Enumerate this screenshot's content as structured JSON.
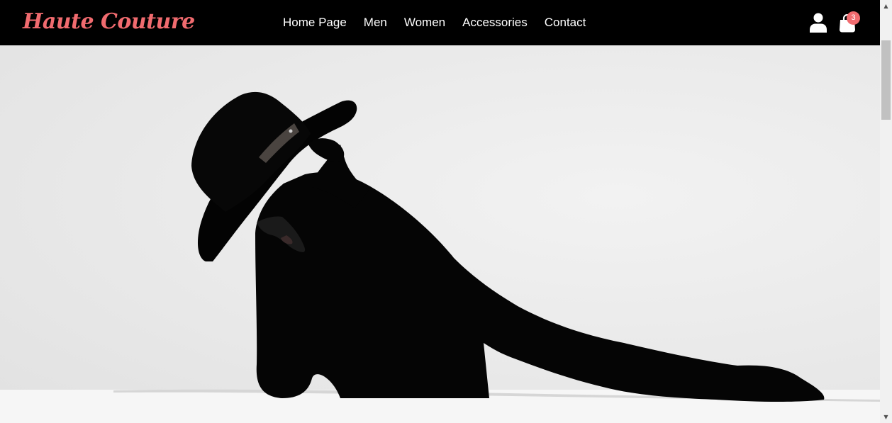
{
  "brand": {
    "name": "Haute Couture",
    "color": "#f16b6f"
  },
  "nav": {
    "items": [
      {
        "label": "Home Page"
      },
      {
        "label": "Men"
      },
      {
        "label": "Women"
      },
      {
        "label": "Accessories"
      },
      {
        "label": "Contact"
      }
    ]
  },
  "header_icons": {
    "user": "user-icon",
    "cart": "shopping-bag-icon",
    "cart_count": "3"
  },
  "hero": {
    "image": "black-and-white photo of model in black hat and black outfit leaning on white surface"
  },
  "scrollbar": {
    "up": "▲",
    "down": "▼"
  }
}
